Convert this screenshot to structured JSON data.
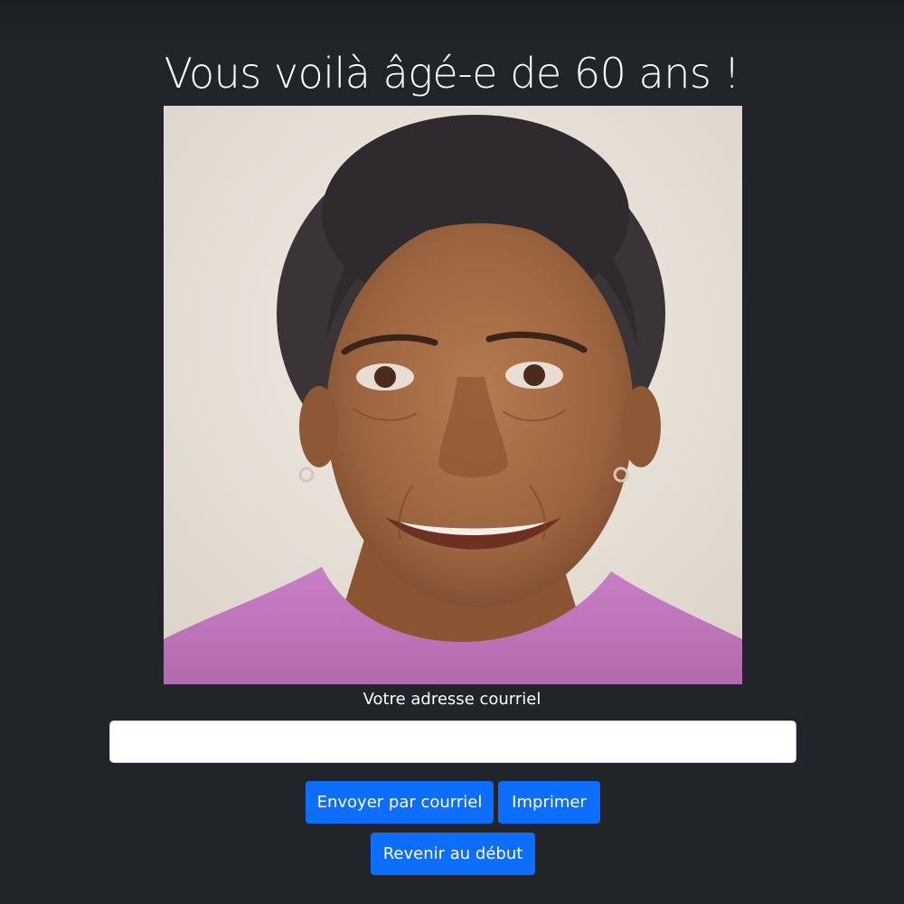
{
  "page": {
    "title": "Vous voilà âgé-e de 60 ans !"
  },
  "photo": {
    "subject": "aged-face-portrait"
  },
  "form": {
    "email_label": "Votre adresse courriel",
    "email_value": "",
    "email_placeholder": ""
  },
  "buttons": {
    "send_email": "Envoyer par courriel",
    "print": "Imprimer",
    "restart": "Revenir au début"
  },
  "colors": {
    "background": "#212529",
    "button": "#0d6efd",
    "shirt": "#c277c0"
  },
  "icons": []
}
